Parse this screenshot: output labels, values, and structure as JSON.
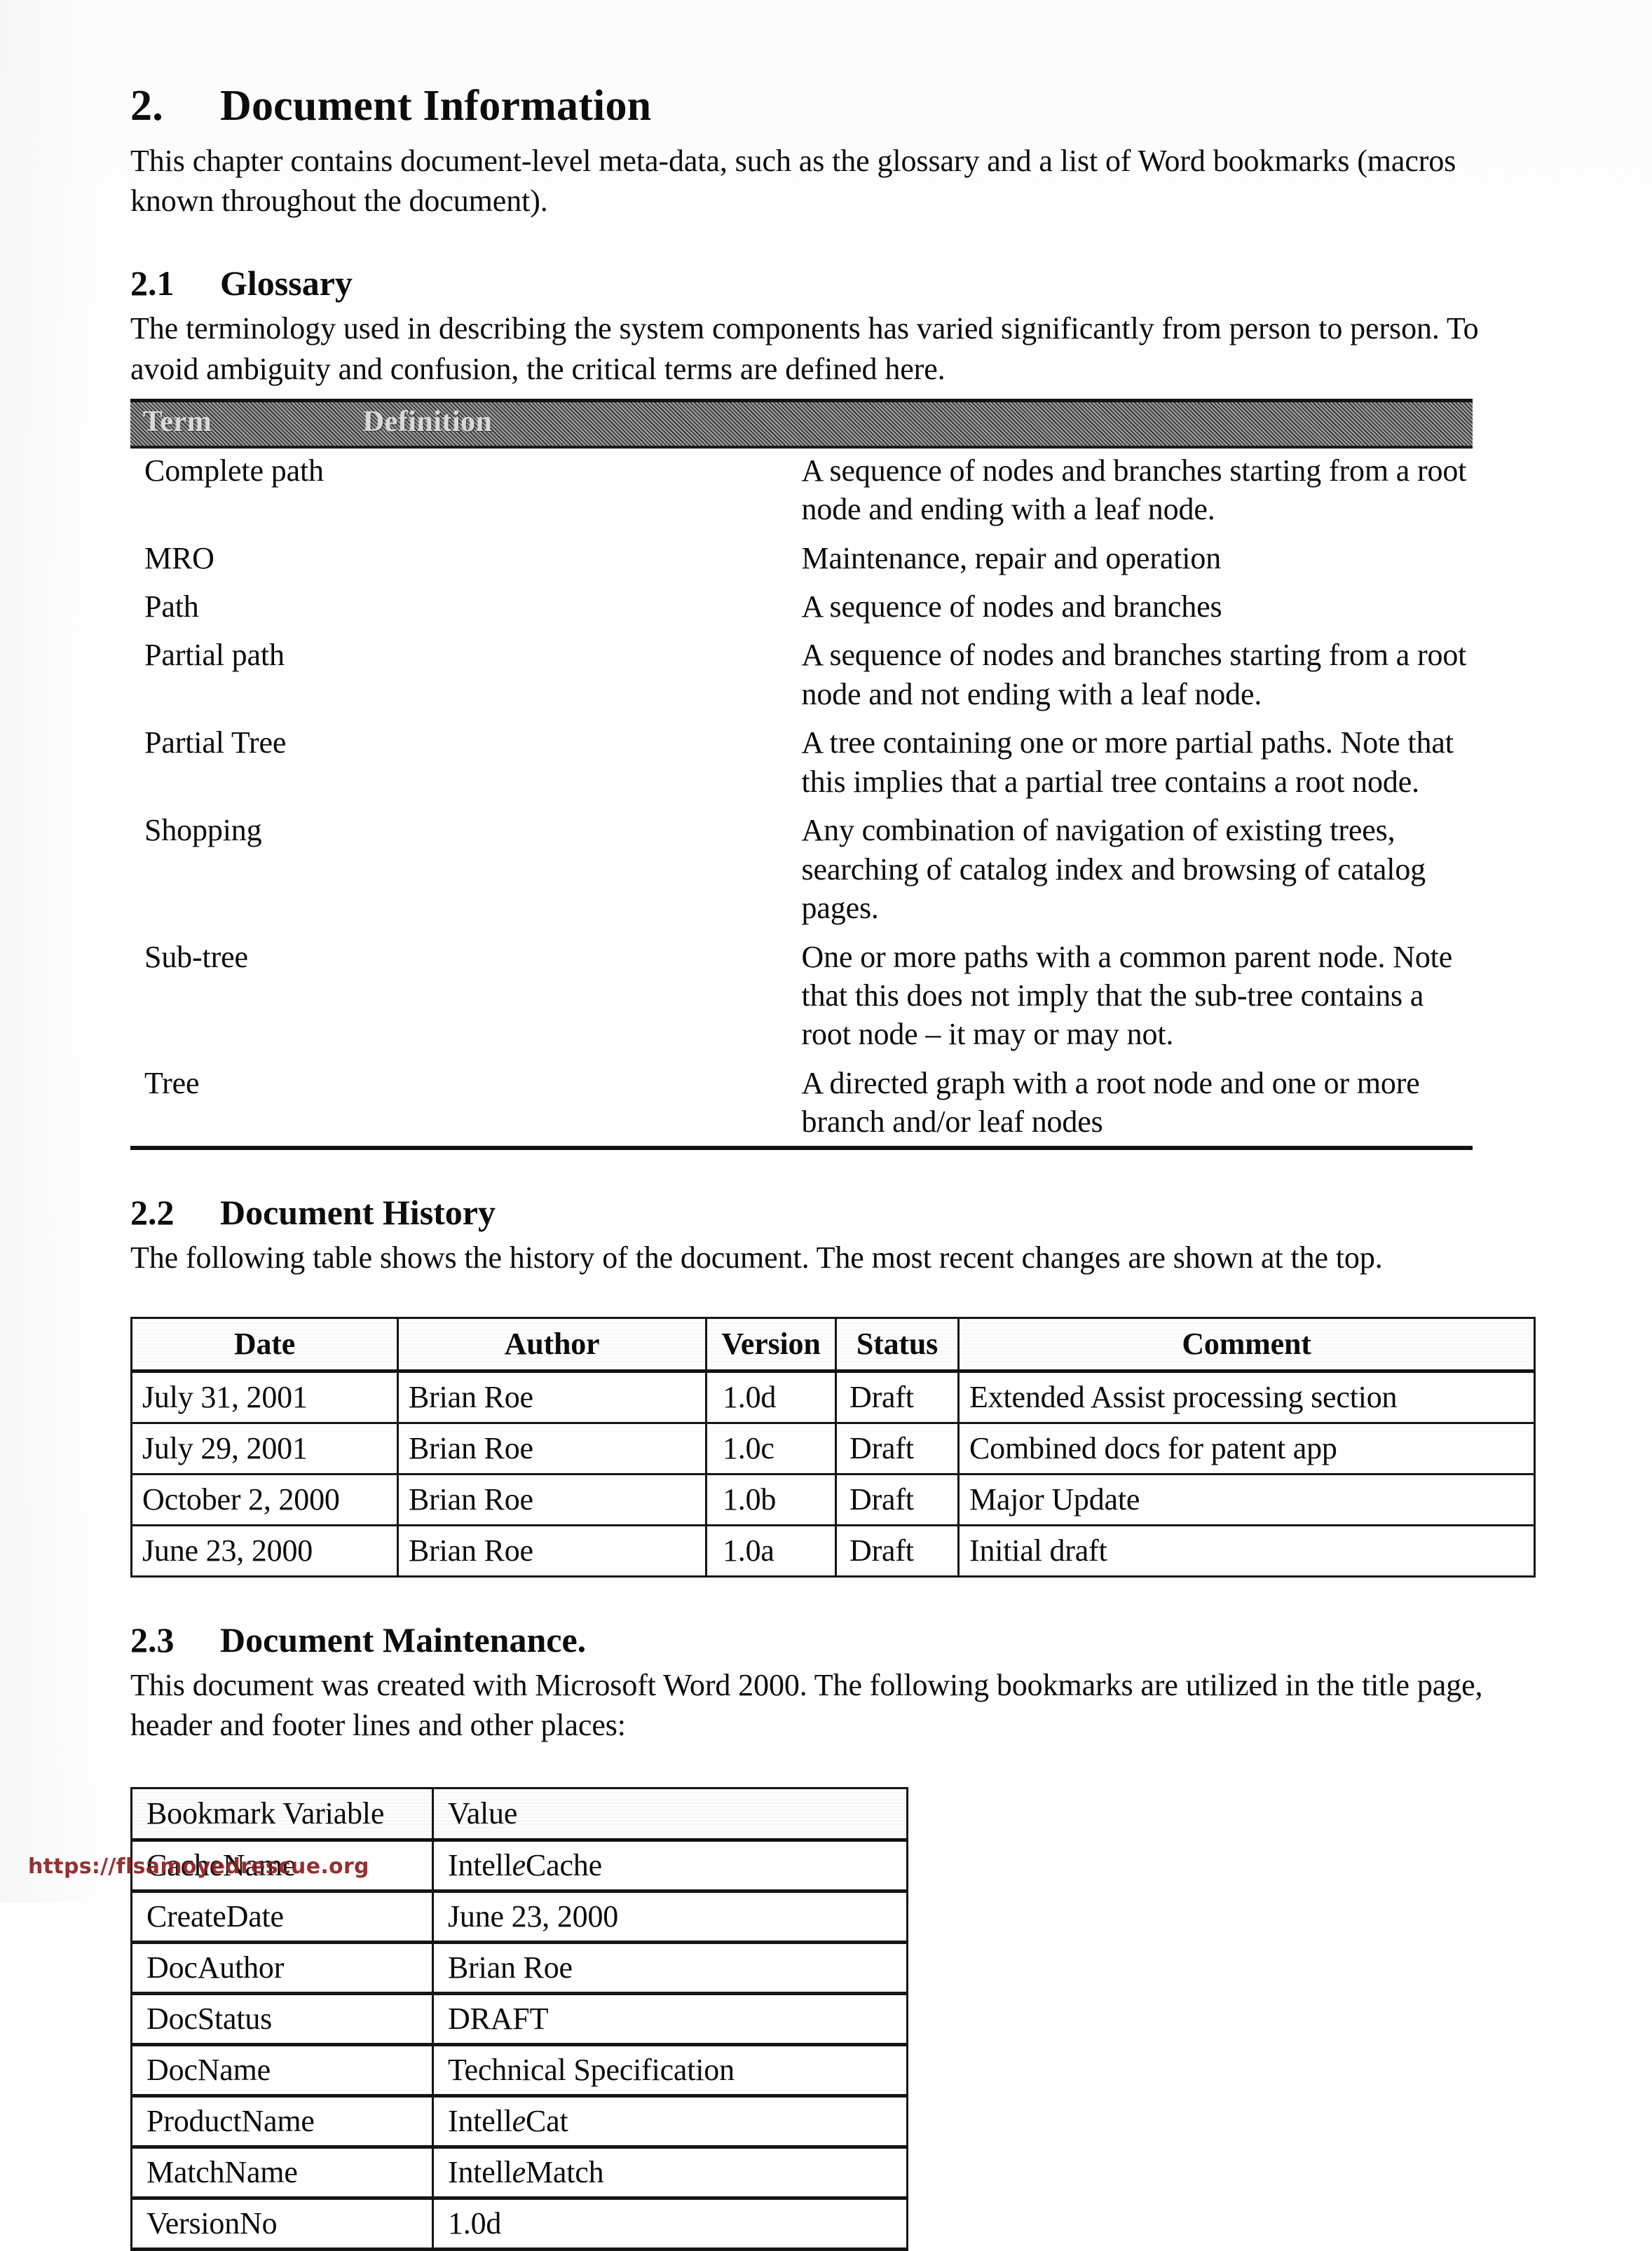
{
  "document": {
    "chapter_number": "2.",
    "chapter_title": "Document Information",
    "intro": "This chapter contains document-level meta-data, such as the glossary and a list of Word bookmarks (macros known throughout the document)."
  },
  "glossary_section": {
    "number": "2.1",
    "title": "Glossary",
    "intro": "The terminology used in describing the system components has varied significantly from person to person.  To avoid ambiguity and confusion, the critical terms are defined here.",
    "headers": {
      "term": "Term",
      "definition": "Definition"
    },
    "rows": [
      {
        "term": "Complete path",
        "definition": "A sequence of nodes and branches starting from a root node and ending with a leaf node."
      },
      {
        "term": "MRO",
        "definition": "Maintenance, repair and operation"
      },
      {
        "term": "Path",
        "definition": "A sequence of nodes and branches"
      },
      {
        "term": "Partial path",
        "definition": "A sequence of nodes and branches starting from a root node and not ending with a leaf node."
      },
      {
        "term": "Partial Tree",
        "definition": "A tree containing one or more partial paths.  Note that this implies that a partial tree contains a root node."
      },
      {
        "term": "Shopping",
        "definition": "Any combination of navigation of existing trees, searching of catalog index and browsing of catalog pages."
      },
      {
        "term": "Sub-tree",
        "definition": "One or more paths with a common parent node.  Note that this does not imply that the sub-tree contains a root node – it may or may not."
      },
      {
        "term": "Tree",
        "definition": "A directed graph with a root node and one or more branch and/or leaf nodes"
      }
    ]
  },
  "history_section": {
    "number": "2.2",
    "title": "Document History",
    "intro": "The following table shows the history of the document.  The most recent changes are shown at the top.",
    "headers": {
      "date": "Date",
      "author": "Author",
      "version": "Version",
      "status": "Status",
      "comment": "Comment"
    },
    "rows": [
      {
        "date": "July 31, 2001",
        "author": "Brian Roe",
        "version": "1.0d",
        "status": "Draft",
        "comment": "Extended Assist processing section"
      },
      {
        "date": "July 29, 2001",
        "author": "Brian Roe",
        "version": "1.0c",
        "status": "Draft",
        "comment": "Combined docs for patent app"
      },
      {
        "date": "October 2, 2000",
        "author": "Brian Roe",
        "version": "1.0b",
        "status": "Draft",
        "comment": "Major Update"
      },
      {
        "date": "June 23, 2000",
        "author": "Brian Roe",
        "version": "1.0a",
        "status": "Draft",
        "comment": "Initial draft"
      }
    ]
  },
  "maintenance_section": {
    "number": "2.3",
    "title": "Document Maintenance.",
    "intro": "This document was created with Microsoft Word 2000. The following bookmarks are utilized in the title page, header and footer lines and other places:",
    "headers": {
      "variable": "Bookmark Variable",
      "value": "Value"
    },
    "rows": [
      {
        "variable": "CacheName",
        "value_pre": "Intell",
        "value_italic": "e",
        "value_post": "Cache"
      },
      {
        "variable": "CreateDate",
        "value_pre": "June 23, 2000",
        "value_italic": "",
        "value_post": ""
      },
      {
        "variable": "DocAuthor",
        "value_pre": "Brian Roe",
        "value_italic": "",
        "value_post": ""
      },
      {
        "variable": "DocStatus",
        "value_pre": "DRAFT",
        "value_italic": "",
        "value_post": ""
      },
      {
        "variable": "DocName",
        "value_pre": "Technical Specification",
        "value_italic": "",
        "value_post": ""
      },
      {
        "variable": "ProductName",
        "value_pre": "Intell",
        "value_italic": "e",
        "value_post": "Cat"
      },
      {
        "variable": "MatchName",
        "value_pre": "Intell",
        "value_italic": "e",
        "value_post": "Match"
      },
      {
        "variable": "VersionNo",
        "value_pre": "1.0d",
        "value_italic": "",
        "value_post": ""
      }
    ]
  },
  "footer": {
    "watermark_url": "https://flsamoyedrescue.org"
  },
  "colors": {
    "text": "#0c0c0c",
    "rule": "#161616",
    "glossary_header_bg": "#6f6f6f",
    "watermark": "#8d1f21"
  }
}
